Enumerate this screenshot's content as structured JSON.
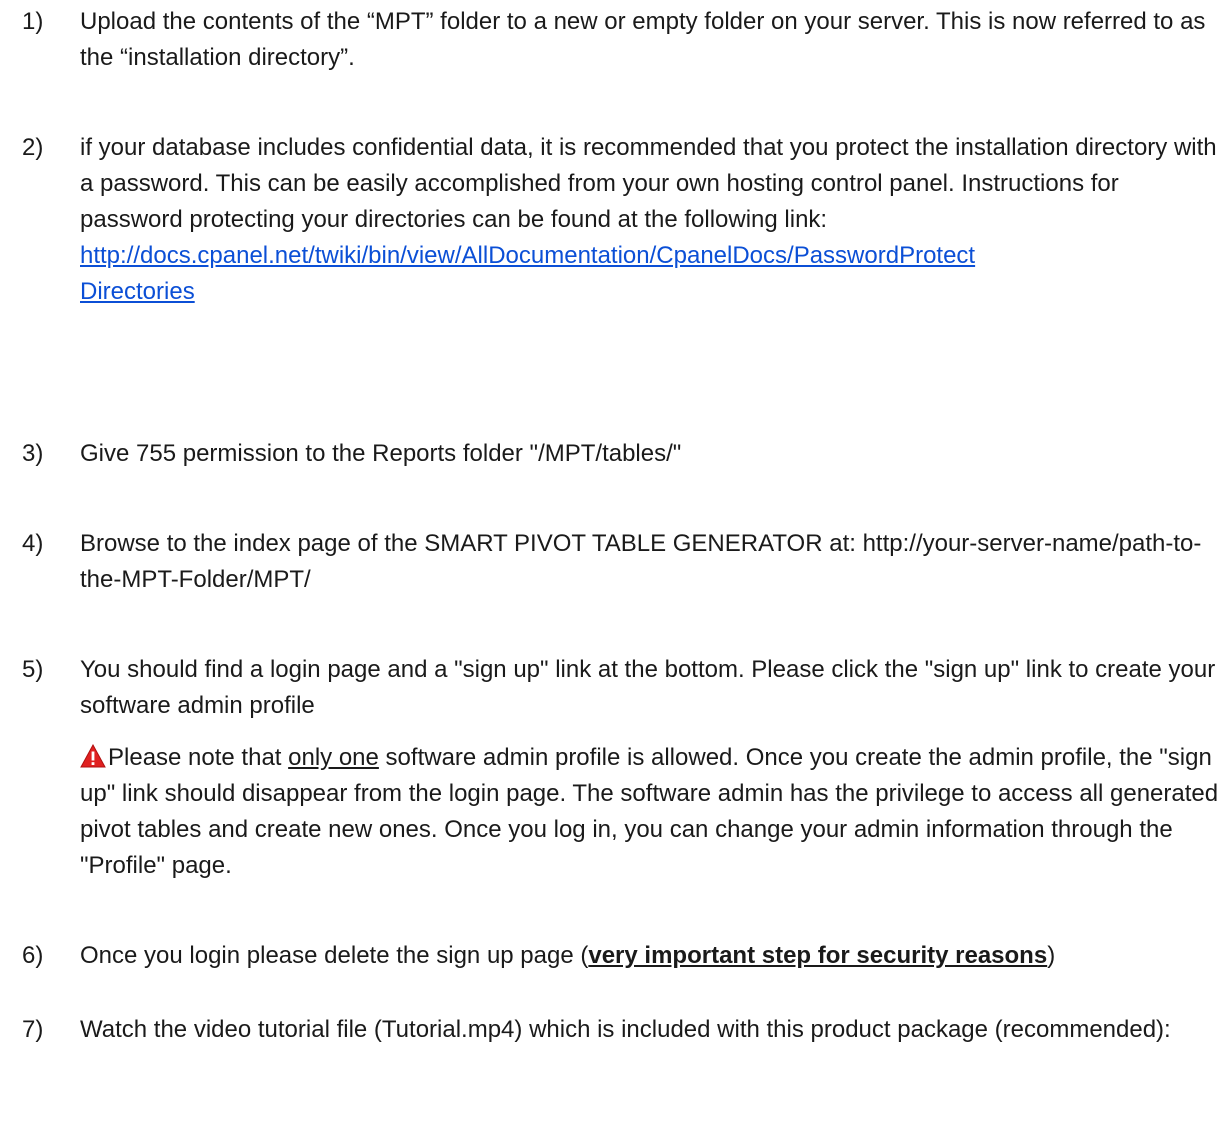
{
  "steps": [
    {
      "number": "1)",
      "text": "Upload the contents of the “MPT” folder to a new or empty folder on your server. This is now referred to as the “installation directory”."
    },
    {
      "number": "2)",
      "text": "if your database includes confidential data, it is recommended that you protect the installation directory with a password. This can be easily accomplished from your own hosting control panel. Instructions for password protecting your directories can be found at the following link:",
      "link_line1": "http://docs.cpanel.net/twiki/bin/view/AllDocumentation/CpanelDocs/PasswordProtect",
      "link_line2": "Directories"
    },
    {
      "number": "3)",
      "text": "Give 755 permission to the Reports folder \"/MPT/tables/\""
    },
    {
      "number": "4)",
      "text": "Browse to the index page of the SMART PIVOT TABLE GENERATOR at:  http://your-server-name/path-to-the-MPT-Folder/MPT/"
    },
    {
      "number": "5)",
      "text": "You should find a login page and a \"sign up\" link at the bottom. Please click the \"sign up\" link to create your software admin profile",
      "note_icon": "warning-icon",
      "note_before": "Please note that ",
      "note_underlined": "only one",
      "note_after": " software admin profile is allowed. Once you create the admin profile, the \"sign up\" link should disappear from the login page. The software admin has the privilege to access all generated pivot tables and create new ones. Once you log in, you can change your admin information through the \"Profile\" page."
    },
    {
      "number": "6)",
      "text_before": "Once you login please delete the sign up page (",
      "emphasis": "very important step for security reasons",
      "text_after": ")"
    },
    {
      "number": "7)",
      "text": "Watch the video tutorial file (Tutorial.mp4) which is included with this product package (recommended):"
    }
  ],
  "colors": {
    "link": "#0b4fd6",
    "warning": "#e02020",
    "text": "#1a1a1a"
  }
}
